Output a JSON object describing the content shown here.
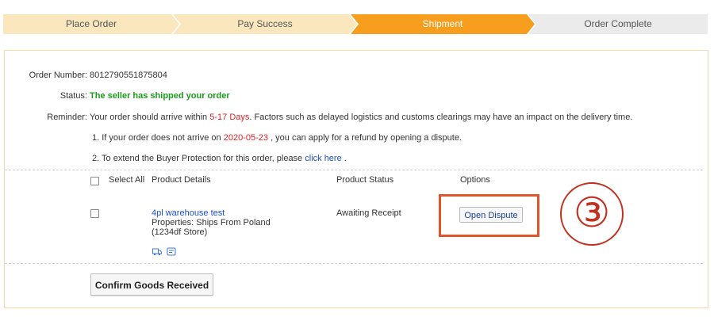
{
  "steps": [
    {
      "label": "Place Order"
    },
    {
      "label": "Pay Success"
    },
    {
      "label": "Shipment"
    },
    {
      "label": "Order Complete"
    }
  ],
  "order": {
    "number_label": "Order Number:",
    "number": "8012790551875804",
    "status_label": "Status:",
    "status": "The seller has shipped your order",
    "reminder_label": "Reminder:",
    "reminder_prefix": "Your order should arrive within",
    "reminder_days": "5-17 Days",
    "reminder_suffix": ". Factors such as delayed logistics and customs clearings may have an impact on the delivery time.",
    "note1_prefix": "1. If your order does not arrive on",
    "note1_date": "2020-05-23",
    "note1_suffix": ", you can apply for a refund by opening a dispute.",
    "note2_prefix": "2. To extend the Buyer Protection for this order, please",
    "note2_link": "click here",
    "note2_suffix": "."
  },
  "table": {
    "select_all": "Select All",
    "col_details": "Product Details",
    "col_status": "Product Status",
    "col_options": "Options"
  },
  "product": {
    "name": "4pl warehouse test",
    "properties": "Properties: Ships From Poland",
    "store": "(1234df Store)",
    "status": "Awaiting Receipt",
    "dispute_button": "Open Dispute"
  },
  "annotation": {
    "number": "③"
  },
  "confirm_button": "Confirm Goods Received",
  "colors": {
    "active_step": "#f89e1f",
    "done_step": "#fbe7bd",
    "pending_step": "#ebebeb",
    "highlight": "#e0542a"
  }
}
